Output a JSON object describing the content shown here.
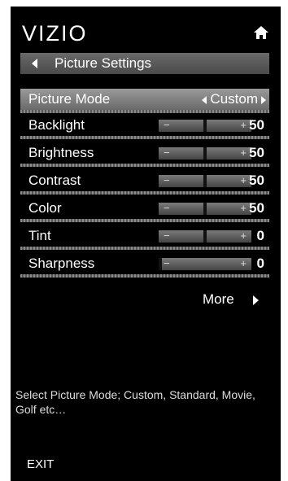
{
  "app": {
    "logo": "VIZIO"
  },
  "header": {
    "title": "Picture Settings"
  },
  "picture_mode": {
    "label": "Picture Mode",
    "value": "Custom"
  },
  "settings": [
    {
      "label": "Backlight",
      "value": "50",
      "level": 50
    },
    {
      "label": "Brightness",
      "value": "50",
      "level": 50
    },
    {
      "label": "Contrast",
      "value": "50",
      "level": 50
    },
    {
      "label": "Color",
      "value": "50",
      "level": 50
    },
    {
      "label": "Tint",
      "value": "0",
      "level": 50
    },
    {
      "label": "Sharpness",
      "value": "0",
      "level": 0
    }
  ],
  "slider": {
    "minus": "−",
    "plus": "+"
  },
  "more": {
    "label": "More"
  },
  "description": "Select Picture Mode; Custom, Standard, Movie, Golf etc…",
  "exit": {
    "label": "EXIT"
  },
  "colors": {
    "background": "#000000",
    "selected": "#8a8a8a",
    "text": "#ffffff"
  }
}
